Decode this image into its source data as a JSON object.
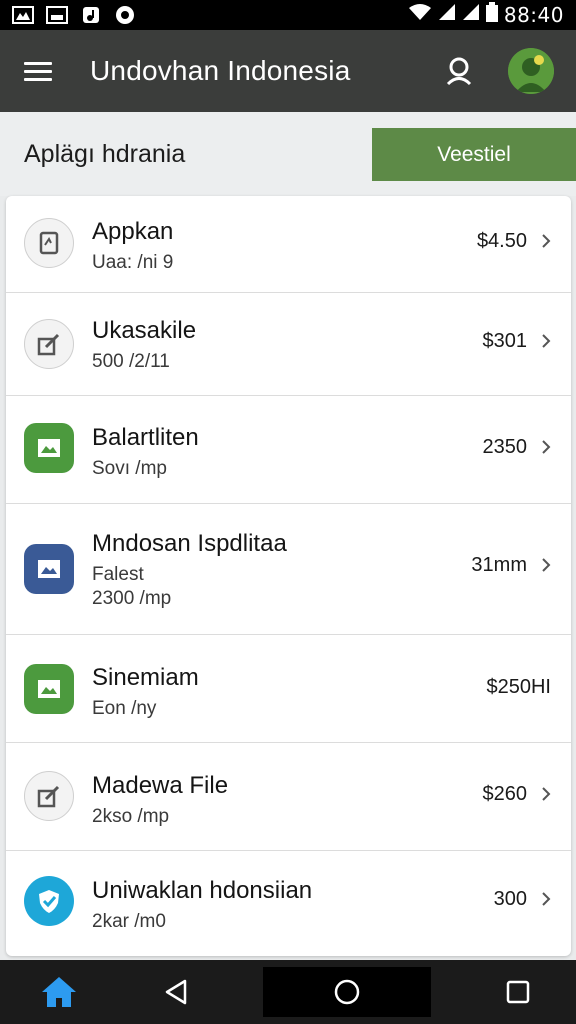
{
  "status_bar": {
    "time": "88:40",
    "left_icons": [
      "gallery-icon",
      "message-icon",
      "music-icon",
      "sync-icon"
    ],
    "right_icons": [
      "wifi-icon",
      "signal-icon",
      "signal-icon",
      "battery-icon"
    ]
  },
  "app_bar": {
    "title": "Undovhan Indonesia",
    "icons": [
      "menu-icon",
      "search-icon",
      "avatar"
    ]
  },
  "section": {
    "title": "Aplägı hdrania",
    "action_label": "Veestiel"
  },
  "items": [
    {
      "title": "Appkan",
      "subtitle": "Uaa: /ni 9",
      "value": "$4.50",
      "icon": "document-icon"
    },
    {
      "title": "Ukasakile",
      "subtitle": "500 /2/11",
      "value": "$301",
      "icon": "edit-icon"
    },
    {
      "title": "Balartliten",
      "subtitle": "Sovı /mp",
      "value": "2350",
      "icon": "image-icon"
    },
    {
      "title": "Mndosan Ispdlitaa",
      "subtitle": "Falest",
      "subtitle2": "2300 /mp",
      "value": "31mm",
      "icon": "image-icon"
    },
    {
      "title": "Sinemiam",
      "subtitle": "Eon /ny",
      "value": "$250HI",
      "icon": "image-icon"
    },
    {
      "title": "Madewa File",
      "subtitle": "2kso /mp",
      "value": "$260",
      "icon": "edit-icon"
    },
    {
      "title": "Uniwaklan hdonsiian",
      "subtitle": "2kar /m0",
      "value": "300",
      "icon": "shield-check-icon"
    }
  ],
  "colors": {
    "app_bar": "#3b3d3b",
    "accent": "#5d8a47",
    "green_icon": "#4c9a3e",
    "blue_icon": "#3a5a96",
    "cyan_icon": "#1ea7d8"
  },
  "nav": [
    "home-icon",
    "back-icon",
    "home-circle-icon",
    "recents-icon"
  ]
}
